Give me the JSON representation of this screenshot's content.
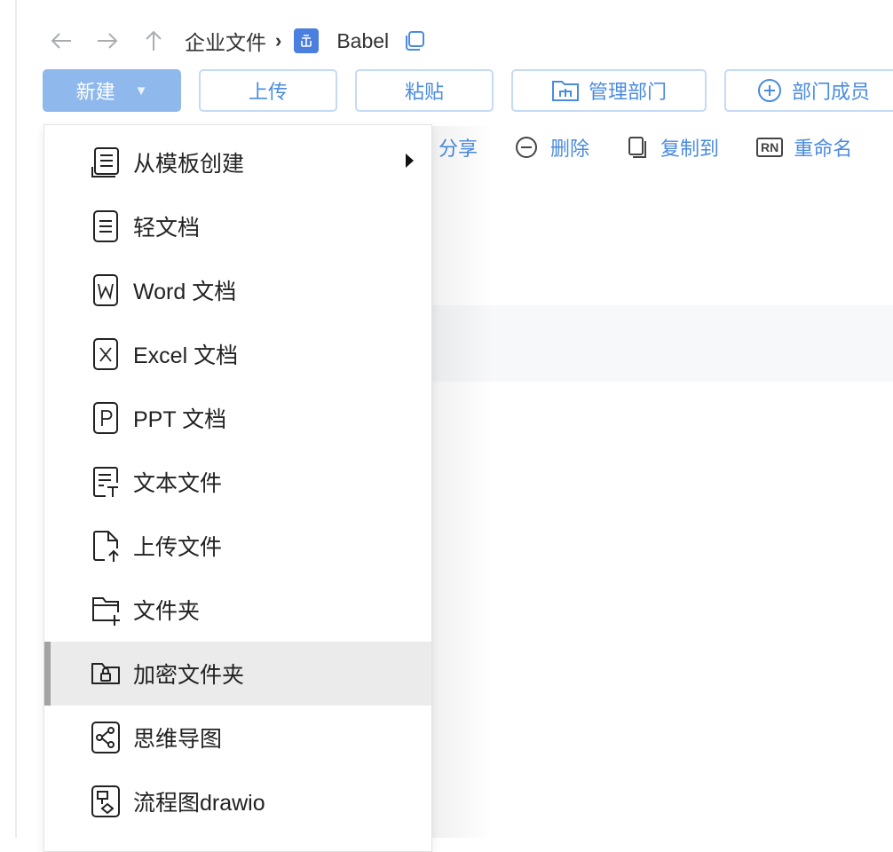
{
  "breadcrumb": {
    "root": "企业文件",
    "separator": "›",
    "current": "Babel",
    "space_icon_color": "#4a7fe0"
  },
  "toolbar": {
    "new_label": "新建",
    "new_caret": "▼",
    "upload_label": "上传",
    "paste_label": "粘贴",
    "manage_dept_label": "管理部门",
    "dept_members_label": "部门成员",
    "accent_color": "#4a8be0",
    "primary_bg": "#8fb8ec"
  },
  "actions": {
    "share_label": "分享",
    "delete_label": "删除",
    "copy_to_label": "复制到",
    "rename_badge": "RN",
    "rename_label": "重命名"
  },
  "new_menu": {
    "items": [
      {
        "label": "从模板创建",
        "icon": "template-icon",
        "has_submenu": true
      },
      {
        "label": "轻文档",
        "icon": "light-doc-icon"
      },
      {
        "label": "Word 文档",
        "icon": "word-doc-icon",
        "letter": "W"
      },
      {
        "label": "Excel 文档",
        "icon": "excel-doc-icon",
        "letter": "X"
      },
      {
        "label": "PPT 文档",
        "icon": "ppt-doc-icon",
        "letter": "P"
      },
      {
        "label": "文本文件",
        "icon": "text-file-icon"
      },
      {
        "label": "上传文件",
        "icon": "upload-file-icon"
      },
      {
        "label": "文件夹",
        "icon": "new-folder-icon"
      },
      {
        "label": "加密文件夹",
        "icon": "encrypted-folder-icon",
        "active": true
      },
      {
        "label": "思维导图",
        "icon": "mindmap-icon"
      },
      {
        "label": "流程图drawio",
        "icon": "flowchart-icon"
      }
    ]
  }
}
